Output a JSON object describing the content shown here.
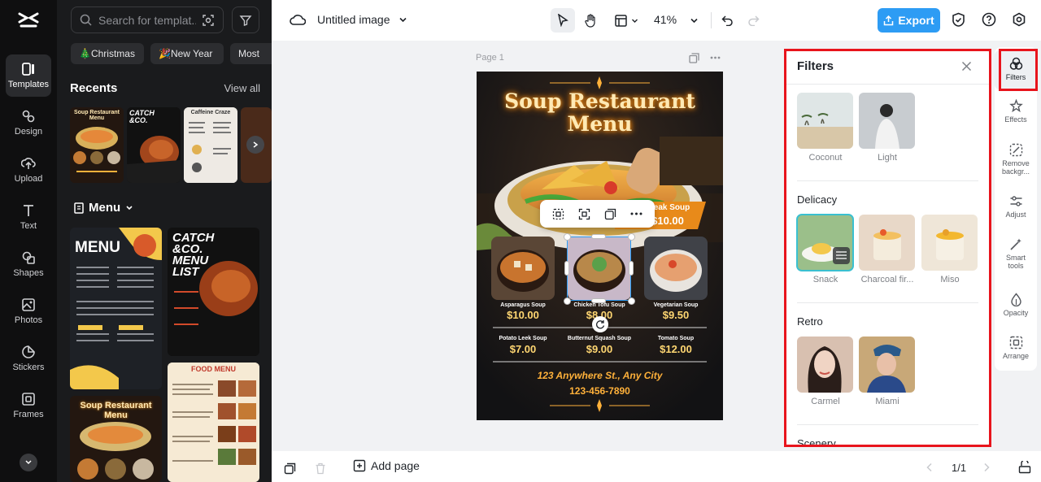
{
  "app": {
    "name": "CapCut",
    "file_title": "Untitled image",
    "zoom": "41%",
    "export_label": "Export",
    "accent_color": "#2d9cf4"
  },
  "rail": {
    "items": [
      {
        "label": "Templates",
        "icon": "templates-icon",
        "active": true
      },
      {
        "label": "Design",
        "icon": "design-icon"
      },
      {
        "label": "Upload",
        "icon": "upload-icon"
      },
      {
        "label": "Text",
        "icon": "text-icon"
      },
      {
        "label": "Shapes",
        "icon": "shapes-icon"
      },
      {
        "label": "Photos",
        "icon": "photos-icon"
      },
      {
        "label": "Stickers",
        "icon": "stickers-icon"
      },
      {
        "label": "Frames",
        "icon": "frames-icon"
      }
    ]
  },
  "templates": {
    "search_placeholder": "Search for templat...",
    "chips": [
      "🎄Christmas",
      "🎉New Year",
      "Most"
    ],
    "recents_title": "Recents",
    "view_all": "View all",
    "recent_thumbs": [
      {
        "title": "Soup Restaurant Menu"
      },
      {
        "title": "CATCH &CO."
      },
      {
        "title": "Caffeine Craze"
      }
    ],
    "menu_title": "Menu",
    "menu_thumbs": [
      {
        "title": "MENU"
      },
      {
        "title": "CATCH &CO. MENU LIST"
      },
      {
        "title": "Soup Restaurant Menu"
      },
      {
        "title": "FOOD MENU"
      }
    ]
  },
  "canvas": {
    "page_label": "Page 1",
    "poster": {
      "title_line1": "Soup Restaurant",
      "title_line2": "Menu",
      "banner_name": "Steak Soup",
      "banner_price": "$10.00",
      "items": [
        {
          "name": "Asparagus Soup",
          "price": "$10.00"
        },
        {
          "name": "Chicken Tofu Soup",
          "price": "$8.00"
        },
        {
          "name": "Vegetarian Soup",
          "price": "$9.50"
        },
        {
          "name": "Potato Leek Soup",
          "price": "$7.00"
        },
        {
          "name": "Butternut Squash Soup",
          "price": "$9.00"
        },
        {
          "name": "Tomato Soup",
          "price": "$12.00"
        }
      ],
      "address": "123 Anywhere St., Any City",
      "phone": "123-456-7890"
    }
  },
  "bottom": {
    "add_page": "Add page",
    "pager": "1/1"
  },
  "filters": {
    "title": "Filters",
    "sections": [
      {
        "title": "",
        "items": [
          {
            "label": "Coconut"
          },
          {
            "label": "Light"
          }
        ]
      },
      {
        "title": "Delicacy",
        "items": [
          {
            "label": "Snack",
            "selected": true
          },
          {
            "label": "Charcoal fir..."
          },
          {
            "label": "Miso"
          }
        ]
      },
      {
        "title": "Retro",
        "items": [
          {
            "label": "Carmel"
          },
          {
            "label": "Miami"
          }
        ]
      },
      {
        "title": "Scenery",
        "items": []
      }
    ],
    "highlight_color": "#e8141c"
  },
  "right_tools": [
    {
      "label": "Filters",
      "active": true
    },
    {
      "label": "Effects"
    },
    {
      "label": "Remove backgr..."
    },
    {
      "label": "Adjust"
    },
    {
      "label": "Smart tools"
    },
    {
      "label": "Opacity"
    },
    {
      "label": "Arrange"
    }
  ]
}
